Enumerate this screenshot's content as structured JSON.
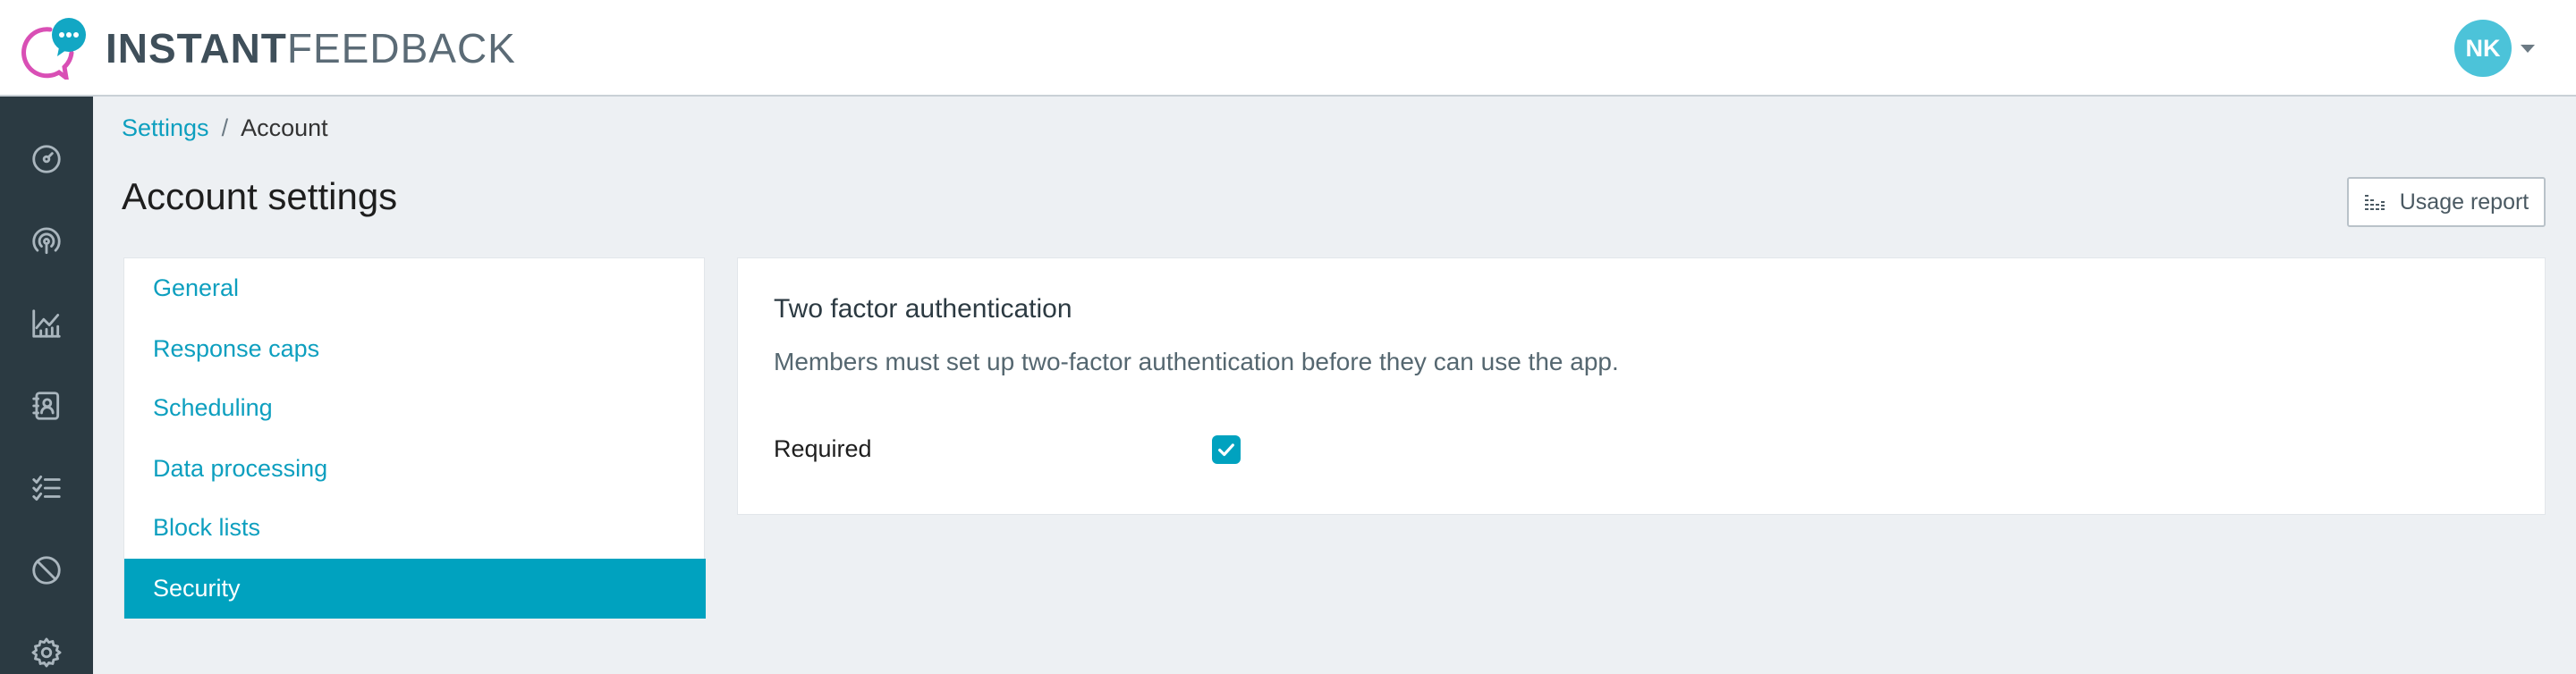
{
  "header": {
    "brand_bold": "INSTANT",
    "brand_light": "FEEDBACK",
    "user_initials": "NK"
  },
  "sidebar": {
    "icons": [
      "dashboard-icon",
      "broadcast-icon",
      "analytics-icon",
      "contacts-icon",
      "checklist-icon",
      "blocked-icon",
      "gear-icon"
    ]
  },
  "breadcrumb": {
    "parent": "Settings",
    "separator": "/",
    "current": "Account"
  },
  "page": {
    "title": "Account settings",
    "usage_button": "Usage report"
  },
  "menu": {
    "items": [
      {
        "label": "General"
      },
      {
        "label": "Response caps"
      },
      {
        "label": "Scheduling"
      },
      {
        "label": "Data processing"
      },
      {
        "label": "Block lists"
      },
      {
        "label": "Security"
      }
    ],
    "active": "Security"
  },
  "card": {
    "title": "Two factor authentication",
    "description": "Members must set up two-factor authentication before they can use the app.",
    "required_label": "Required",
    "required_checked": true
  },
  "colors": {
    "accent": "#00a2bf",
    "sidebar": "#2b3a42",
    "background": "#edf0f3",
    "avatar": "#4cc3d9",
    "logo_pink": "#d94fb5"
  }
}
